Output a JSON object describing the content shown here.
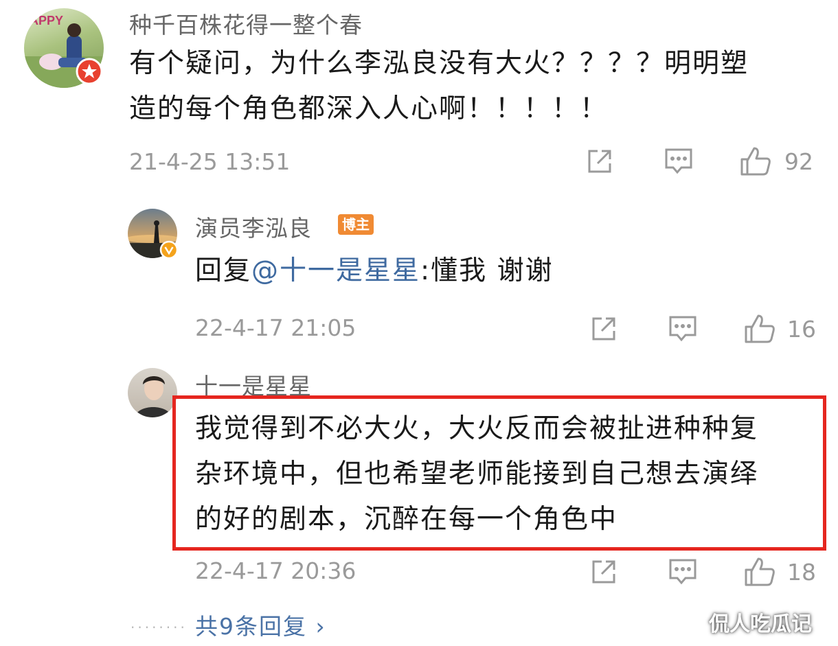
{
  "comment1": {
    "username": "种千百株花得一整个春",
    "text_line1": "有个疑问，为什么李泓良没有大火？？？？明明塑",
    "text_line2": "造的每个角色都深入人心啊！！！！！",
    "time": "21-4-25 13:51",
    "like_count": "92",
    "avatar_text": "APPY"
  },
  "reply1": {
    "username": "演员李泓良",
    "badge": "博主",
    "prefix": "回复",
    "mention": "@十一是星星",
    "suffix": ":懂我 谢谢",
    "time": "22-4-17 21:05",
    "like_count": "16"
  },
  "reply2": {
    "username": "十一是星星",
    "text_line1": "我觉得到不必大火，大火反而会被扯进种种复",
    "text_line2": "杂环境中，但也希望老师能接到自己想去演绎",
    "text_line3": "的好的剧本，沉醉在每一个角色中",
    "time": "22-4-17 20:36",
    "like_count": "18"
  },
  "footer": {
    "dots": "........",
    "more_replies": "共9条回复 ›",
    "watermark": "侃人吃瓜记"
  },
  "icons": [
    "share-icon",
    "comment-icon",
    "like-icon",
    "verified-badge-icon"
  ]
}
